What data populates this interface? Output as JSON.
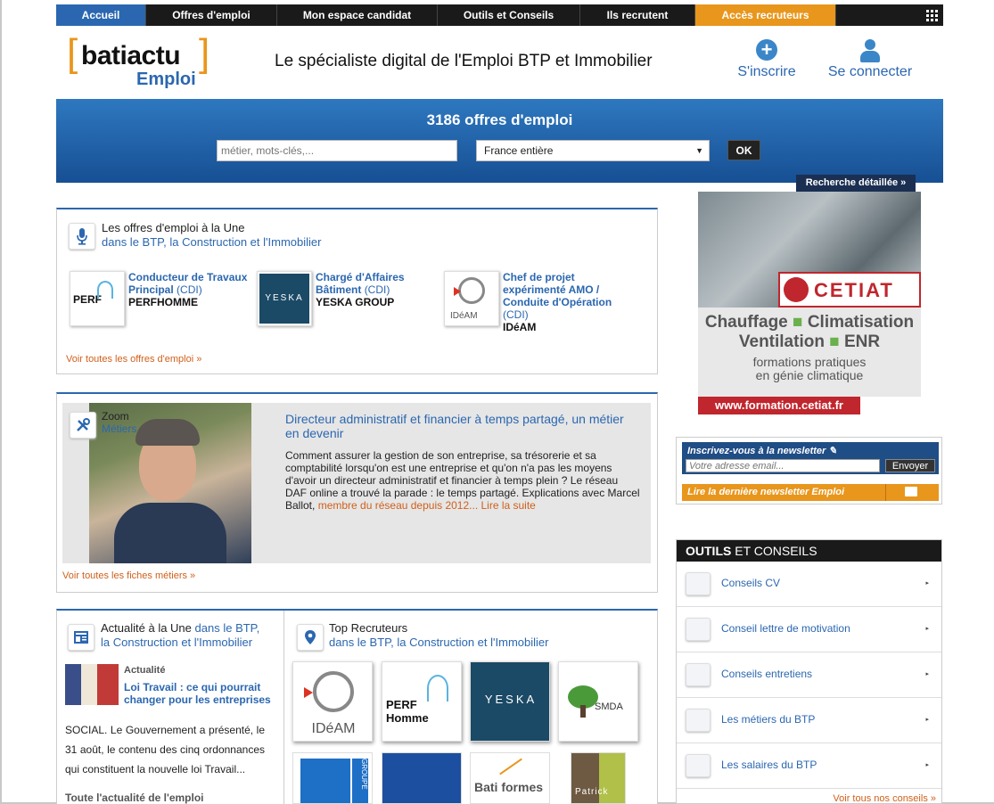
{
  "nav": {
    "items": [
      "Accueil",
      "Offres d'emploi",
      "Mon espace candidat",
      "Outils et Conseils",
      "Ils recrutent",
      "Accès recruteurs"
    ]
  },
  "header": {
    "logo_word": "batiactu",
    "logo_sub": "Emploi",
    "tagline": "Le spécialiste digital de l'Emploi BTP et Immobilier",
    "signup": "S'inscrire",
    "login": "Se connecter"
  },
  "search": {
    "count": "3186 offres d'emploi",
    "placeholder": "métier, mots-clés,...",
    "location": "France entière",
    "ok": "OK",
    "advanced": "Recherche détaillée »"
  },
  "featured": {
    "title": "Les offres d'emploi à la Une",
    "subtitle": "dans le BTP, la Construction et l'Immobilier",
    "jobs": [
      {
        "title": "Conducteur de Travaux Principal",
        "contract": "(CDI)",
        "company": "PERFHOMME",
        "logo_text": "PERF"
      },
      {
        "title": "Chargé d'Affaires Bâtiment",
        "contract": "(CDI)",
        "company": "YESKA GROUP",
        "logo_text": "YESKA"
      },
      {
        "title": "Chef de projet expérimenté AMO / Conduite d'Opération",
        "contract": "(CDI)",
        "company": "IDéAM",
        "logo_text": "IDéAM"
      }
    ],
    "all_link": "Voir toutes les offres d'emploi »"
  },
  "zoom": {
    "label": "Zoom",
    "label_sub": "Métiers",
    "title": "Directeur administratif et financier à temps partagé, un métier en devenir",
    "text": "Comment assurer la gestion de son entreprise, sa trésorerie et sa comptabilité lorsqu'on est une entreprise et qu'on n'a pas les moyens d'avoir un directeur administratif et financier à temps plein ? Le réseau DAF online a trouvé la parade : le temps partagé. Explications avec Marcel Ballot,",
    "text_more": "membre du réseau depuis 2012... Lire la suite",
    "all_link": "Voir toutes les fiches métiers »"
  },
  "news": {
    "title": "Actualité à la Une",
    "title_sub1": "dans le BTP,",
    "title_sub2": "la Construction et l'Immobilier",
    "tag": "Actualité",
    "headline": "Loi Travail : ce qui pourrait changer pour les entreprises",
    "body": "SOCIAL. Le Gouvernement a présenté, le 31 août, le contenu des cinq ordonnances qui constituent la nouvelle loi Travail...",
    "all_link": "Toute l'actualité de l'emploi"
  },
  "recruiters": {
    "title": "Top Recruteurs",
    "subtitle": "dans le BTP, la Construction et l'Immobilier",
    "tiles": [
      "IDéAM",
      "PERF Homme",
      "YESKA",
      "SMDA",
      "GROUPE",
      "",
      "Bati formes",
      "Patrick"
    ]
  },
  "ad": {
    "brand": "CETIAT",
    "line1": "Chauffage",
    "line1b": "Climatisation",
    "line2": "Ventilation",
    "line2b": "ENR",
    "line3": "formations pratiques",
    "line4": "en génie climatique",
    "url": "www.formation.cetiat.fr"
  },
  "newsletter": {
    "title": "Inscrivez-vous à la newsletter",
    "placeholder": "Votre adresse email...",
    "send": "Envoyer",
    "last": "Lire la dernière newsletter Emploi"
  },
  "tools": {
    "title_bold": "OUTILS",
    "title_rest": "ET CONSEILS",
    "items": [
      "Conseils CV",
      "Conseil lettre de motivation",
      "Conseils entretiens",
      "Les métiers du BTP",
      "Les salaires du BTP"
    ],
    "all_link": "Voir tous nos conseils »"
  },
  "colors": {
    "accent": "#2b67b0",
    "orange": "#e8961c",
    "dark": "#1a1a1a"
  }
}
